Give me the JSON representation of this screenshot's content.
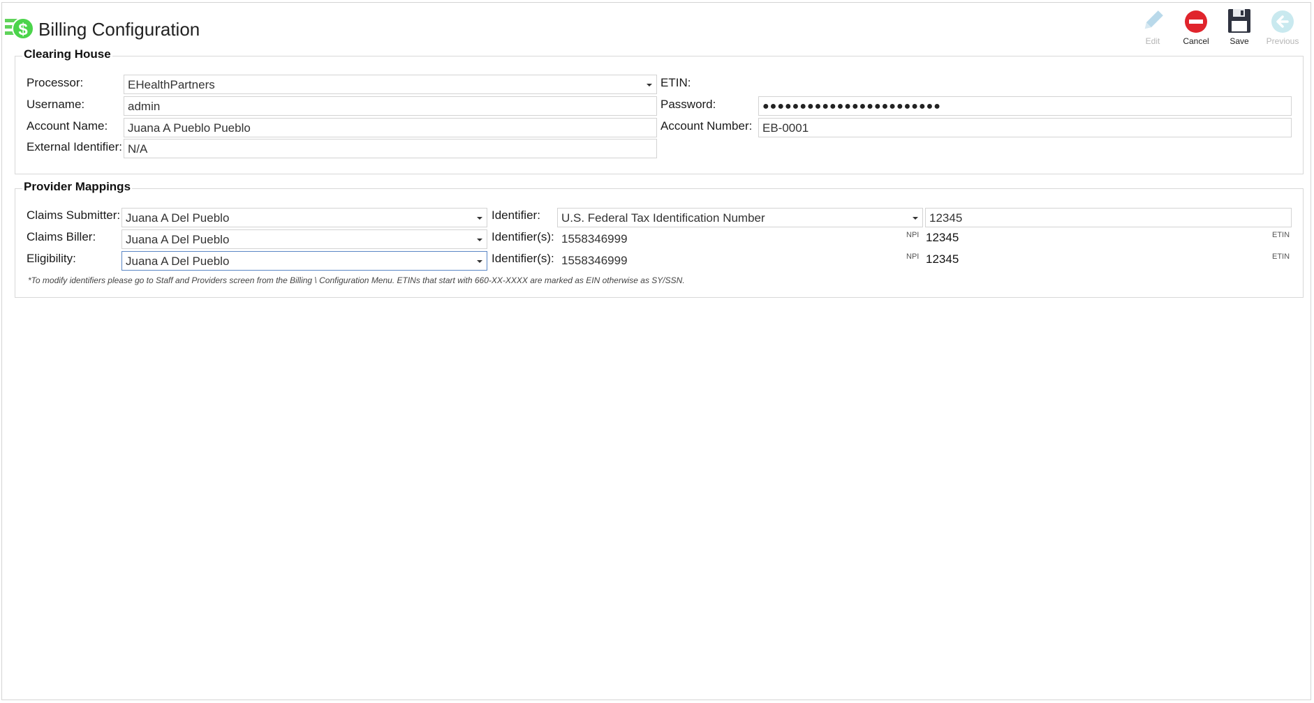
{
  "window": {
    "title": "Billing Configuration"
  },
  "toolbar": {
    "edit": {
      "label": "Edit",
      "icon": "pencil-icon",
      "enabled": false
    },
    "cancel": {
      "label": "Cancel",
      "icon": "no-entry-icon",
      "enabled": true
    },
    "save": {
      "label": "Save",
      "icon": "floppy-disk-icon",
      "enabled": true
    },
    "previous": {
      "label": "Previous",
      "icon": "back-arrow-icon",
      "enabled": false
    }
  },
  "clearing_house": {
    "title": "Clearing House",
    "processor_label": "Processor:",
    "processor_value": "EHealthPartners",
    "username_label": "Username:",
    "username_value": "admin",
    "account_name_label": "Account Name:",
    "account_name_value": "Juana A Pueblo Pueblo",
    "external_identifier_label": "External Identifier:",
    "external_identifier_value": "N/A",
    "etin_label": "ETIN:",
    "password_label": "Password:",
    "password_value": "●●●●●●●●●●●●●●●●●●●●●●●●",
    "account_number_label": "Account Number:",
    "account_number_value": "EB-0001"
  },
  "provider_mappings": {
    "title": "Provider Mappings",
    "claims_submitter_label": "Claims Submitter:",
    "claims_submitter_value": "Juana A Del Pueblo",
    "claims_biller_label": "Claims Biller:",
    "claims_biller_value": "Juana A Del Pueblo",
    "eligibility_label": "Eligibility:",
    "eligibility_value": "Juana A Del Pueblo",
    "identifier_label": "Identifier:",
    "identifier_type_value": "U.S. Federal Tax Identification Number",
    "identifier_value": "12345",
    "identifiers_label": "Identifier(s):",
    "biller_npi": "1558346999",
    "biller_npi_tag": "NPI",
    "biller_etin": "12345",
    "biller_etin_tag": "ETIN",
    "eligibility_npi": "1558346999",
    "eligibility_npi_tag": "NPI",
    "eligibility_etin": "12345",
    "eligibility_etin_tag": "ETIN",
    "footnote": "*To modify identifiers please go to Staff and Providers screen from the Billing \\ Configuration Menu. ETINs that start with 660-XX-XXXX are marked as EIN otherwise as SY/SSN."
  },
  "colors": {
    "accent_green": "#4bd44b",
    "cancel_red": "#e0242c",
    "focus_border": "#5a86c5"
  }
}
